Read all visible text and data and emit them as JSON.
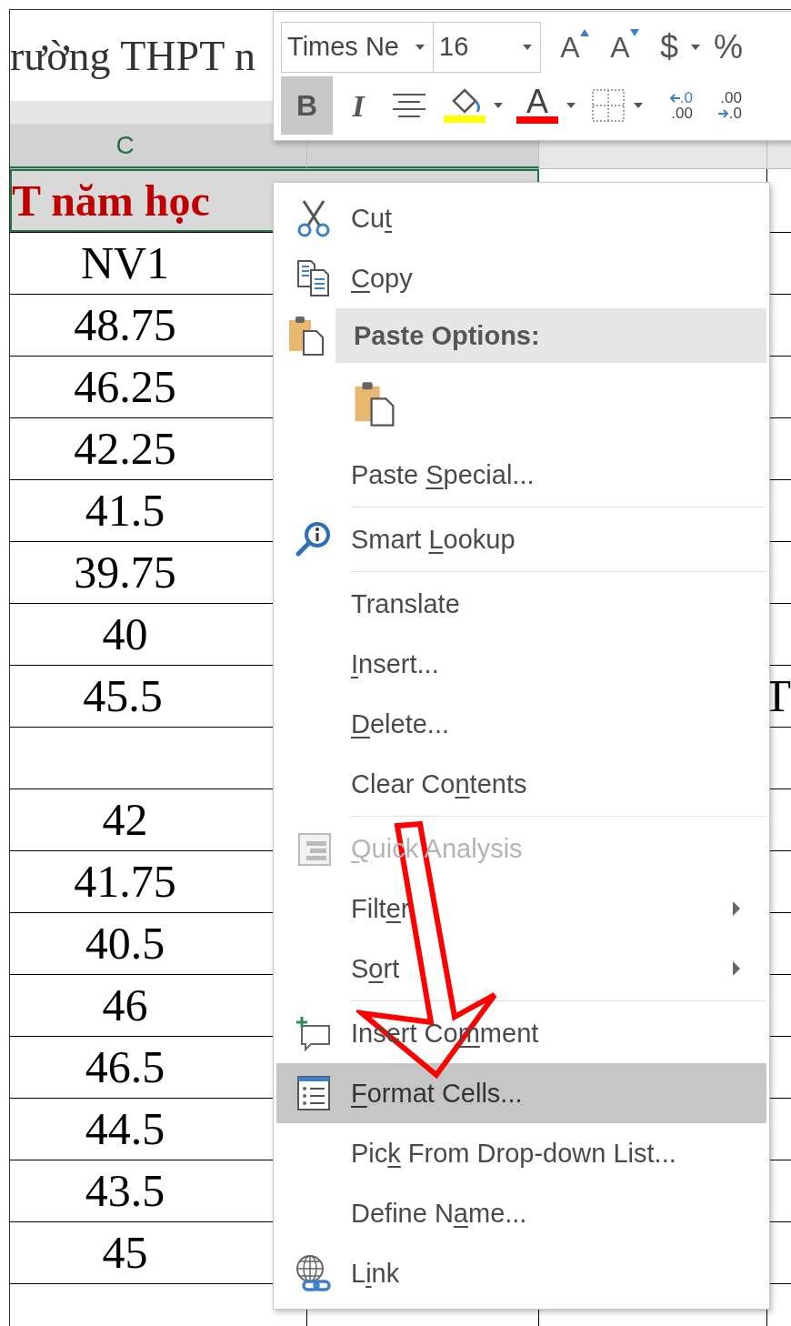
{
  "sheet": {
    "title_fragment": "rường THPT n",
    "columns": [
      {
        "label": "C",
        "selected": true
      }
    ],
    "rows": [
      {
        "kind": "title",
        "cells": {
          "C": "T năm học"
        }
      },
      {
        "kind": "data",
        "cells": {
          "C": "NV1"
        }
      },
      {
        "kind": "data",
        "cells": {
          "C": "48.75"
        }
      },
      {
        "kind": "data",
        "cells": {
          "C": "46.25"
        }
      },
      {
        "kind": "data",
        "cells": {
          "C": "42.25"
        }
      },
      {
        "kind": "data",
        "cells": {
          "C": "41.5"
        }
      },
      {
        "kind": "data",
        "cells": {
          "C": "39.75"
        }
      },
      {
        "kind": "data",
        "cells": {
          "C": "40"
        }
      },
      {
        "kind": "data",
        "cells": {
          "C": "45.5",
          "F": "T"
        }
      },
      {
        "kind": "data"
      },
      {
        "kind": "data",
        "cells": {
          "C": "42"
        }
      },
      {
        "kind": "data",
        "cells": {
          "C": "41.75"
        }
      },
      {
        "kind": "data",
        "cells": {
          "C": "40.5"
        }
      },
      {
        "kind": "data",
        "cells": {
          "C": "46"
        }
      },
      {
        "kind": "data",
        "cells": {
          "C": "46.5"
        }
      },
      {
        "kind": "data",
        "cells": {
          "C": "44.5"
        }
      },
      {
        "kind": "data",
        "cells": {
          "C": "43.5"
        }
      },
      {
        "kind": "data",
        "cells": {
          "C": "45"
        }
      },
      {
        "kind": "data"
      }
    ]
  },
  "mini_toolbar": {
    "font": "Times Ne",
    "size": "16",
    "grow_font": "A",
    "shrink_font": "A",
    "currency": "$",
    "percent": "%",
    "bold": {
      "label": "B",
      "selected": true
    },
    "italic": {
      "label": "I",
      "selected": false
    },
    "font_color": {
      "label": "A"
    },
    "increase_decimal": {
      "top": ".0",
      "bottom": ".00"
    },
    "decrease_decimal": {
      "top": ".00",
      "bottom": ".0"
    }
  },
  "context_menu": {
    "items": [
      {
        "kind": "command",
        "before": "Cu",
        "key": "t",
        "disabled": false,
        "selected": false,
        "submenu": false
      },
      {
        "kind": "command",
        "key": "C",
        "after": "opy",
        "disabled": false,
        "selected": false,
        "submenu": false
      },
      {
        "kind": "header",
        "label": "Paste Options:"
      },
      {
        "kind": "paste_icons"
      },
      {
        "kind": "command",
        "before": "Paste ",
        "key": "S",
        "after": "pecial...",
        "disabled": false,
        "selected": false,
        "submenu": false
      },
      {
        "kind": "separator"
      },
      {
        "kind": "command",
        "before": "Smart ",
        "key": "L",
        "after": "ookup",
        "disabled": false,
        "selected": false,
        "submenu": false
      },
      {
        "kind": "separator"
      },
      {
        "kind": "command",
        "before": "Translate",
        "disabled": false,
        "selected": false,
        "submenu": false
      },
      {
        "kind": "command",
        "key": "I",
        "after": "nsert...",
        "disabled": false,
        "selected": false,
        "submenu": false
      },
      {
        "kind": "command",
        "key": "D",
        "after": "elete...",
        "disabled": false,
        "selected": false,
        "submenu": false
      },
      {
        "kind": "command",
        "before": "Clear Co",
        "key": "n",
        "after": "tents",
        "disabled": false,
        "selected": false,
        "submenu": false
      },
      {
        "kind": "separator"
      },
      {
        "kind": "command",
        "key": "Q",
        "after": "uick Analysis",
        "disabled": true,
        "selected": false,
        "submenu": false
      },
      {
        "kind": "command",
        "before": "Filt",
        "key": "e",
        "after": "r",
        "disabled": false,
        "selected": false,
        "submenu": true
      },
      {
        "kind": "command",
        "before": "S",
        "key": "o",
        "after": "rt",
        "disabled": false,
        "selected": false,
        "submenu": true
      },
      {
        "kind": "separator"
      },
      {
        "kind": "command",
        "before": "Insert Co",
        "key": "m",
        "after": "ment",
        "disabled": false,
        "selected": false,
        "submenu": false
      },
      {
        "kind": "command",
        "key": "F",
        "after": "ormat Cells...",
        "disabled": false,
        "selected": true,
        "submenu": false
      },
      {
        "kind": "command",
        "before": "Pic",
        "key": "k",
        "after": " From Drop-down List...",
        "disabled": false,
        "selected": false,
        "submenu": false
      },
      {
        "kind": "command",
        "before": "Define N",
        "key": "a",
        "after": "me...",
        "disabled": false,
        "selected": false,
        "submenu": false
      },
      {
        "kind": "command",
        "before": "L",
        "key": "i",
        "after": "nk",
        "disabled": false,
        "selected": false,
        "submenu": false
      }
    ]
  }
}
